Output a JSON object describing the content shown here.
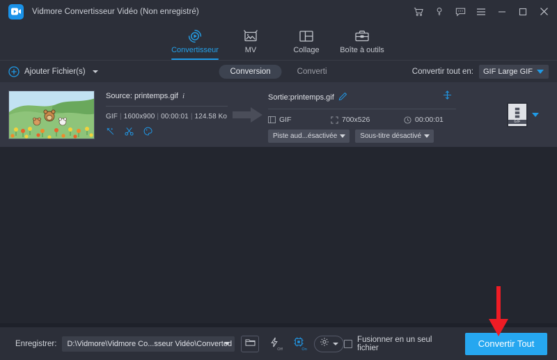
{
  "window": {
    "title": "Vidmore Convertisseur Vidéo (Non enregistré)",
    "logo_icon": "video-camera-icon",
    "controls": [
      {
        "name": "cart-icon",
        "label": "Panier"
      },
      {
        "name": "key-icon",
        "label": "Clé"
      },
      {
        "name": "feedback-icon",
        "label": "Commentaires"
      },
      {
        "name": "menu-icon",
        "label": "Menu"
      },
      {
        "name": "minimize-icon",
        "label": "Réduire"
      },
      {
        "name": "maximize-icon",
        "label": "Agrandir"
      },
      {
        "name": "close-icon",
        "label": "Fermer"
      }
    ]
  },
  "nav": {
    "tabs": [
      {
        "label": "Convertisseur",
        "icon": "convert-circle-icon",
        "active": true
      },
      {
        "label": "MV",
        "icon": "picture-frame-icon",
        "active": false
      },
      {
        "label": "Collage",
        "icon": "collage-grid-icon",
        "active": false
      },
      {
        "label": "Boîte à outils",
        "icon": "toolbox-icon",
        "active": false
      }
    ]
  },
  "toolbar": {
    "add_files_label": "Ajouter Fichier(s)",
    "add_files_icon": "plus-circle-icon",
    "segments": [
      {
        "label": "Conversion",
        "active": true
      },
      {
        "label": "Converti",
        "active": false
      }
    ],
    "convert_all_label": "Convertir tout en:",
    "convert_all_value": "GIF Large GIF"
  },
  "file": {
    "thumbnail_alt": "printemps-gif-thumbnail",
    "source_label": "Source: printemps.gif",
    "info_icon": "info-icon",
    "meta": {
      "format": "GIF",
      "resolution": "1600x900",
      "duration": "00:00:01",
      "size": "124.58 Ko"
    },
    "actions": [
      {
        "name": "magic-wand-icon",
        "label": "Éditer"
      },
      {
        "name": "scissors-icon",
        "label": "Couper"
      },
      {
        "name": "palette-icon",
        "label": "Effets"
      }
    ],
    "output_label": "Sortie:printemps.gif",
    "edit_icon": "pencil-icon",
    "expand_icon": "expand-icon",
    "output_meta": {
      "format": "GIF",
      "resolution": "700x526",
      "duration": "00:00:01"
    },
    "audio_track": "Piste aud...ésactivée",
    "subtitle": "Sous-titre désactivé",
    "format_badge": "GIF"
  },
  "bottom": {
    "save_label": "Enregistrer:",
    "save_path": "D:\\Vidmore\\Vidmore Co...sseur Vidéo\\Converted",
    "open_folder_icon": "folder-icon",
    "speed_icon": "lightning-icon",
    "speed_state": "Off",
    "gpu_icon": "gpu-chip-icon",
    "gpu_state": "On",
    "settings_icon": "gear-icon",
    "merge_label": "Fusionner en un seul fichier",
    "merge_checked": false,
    "convert_button": "Convertir Tout"
  },
  "annotation": {
    "arrow": "red-down-arrow",
    "color": "#ee1c25"
  },
  "colors": {
    "accent": "#1f9ae6",
    "panel": "#2c2f39",
    "card": "#343743",
    "canvas": "#23262f",
    "button": "#26a7f0"
  }
}
